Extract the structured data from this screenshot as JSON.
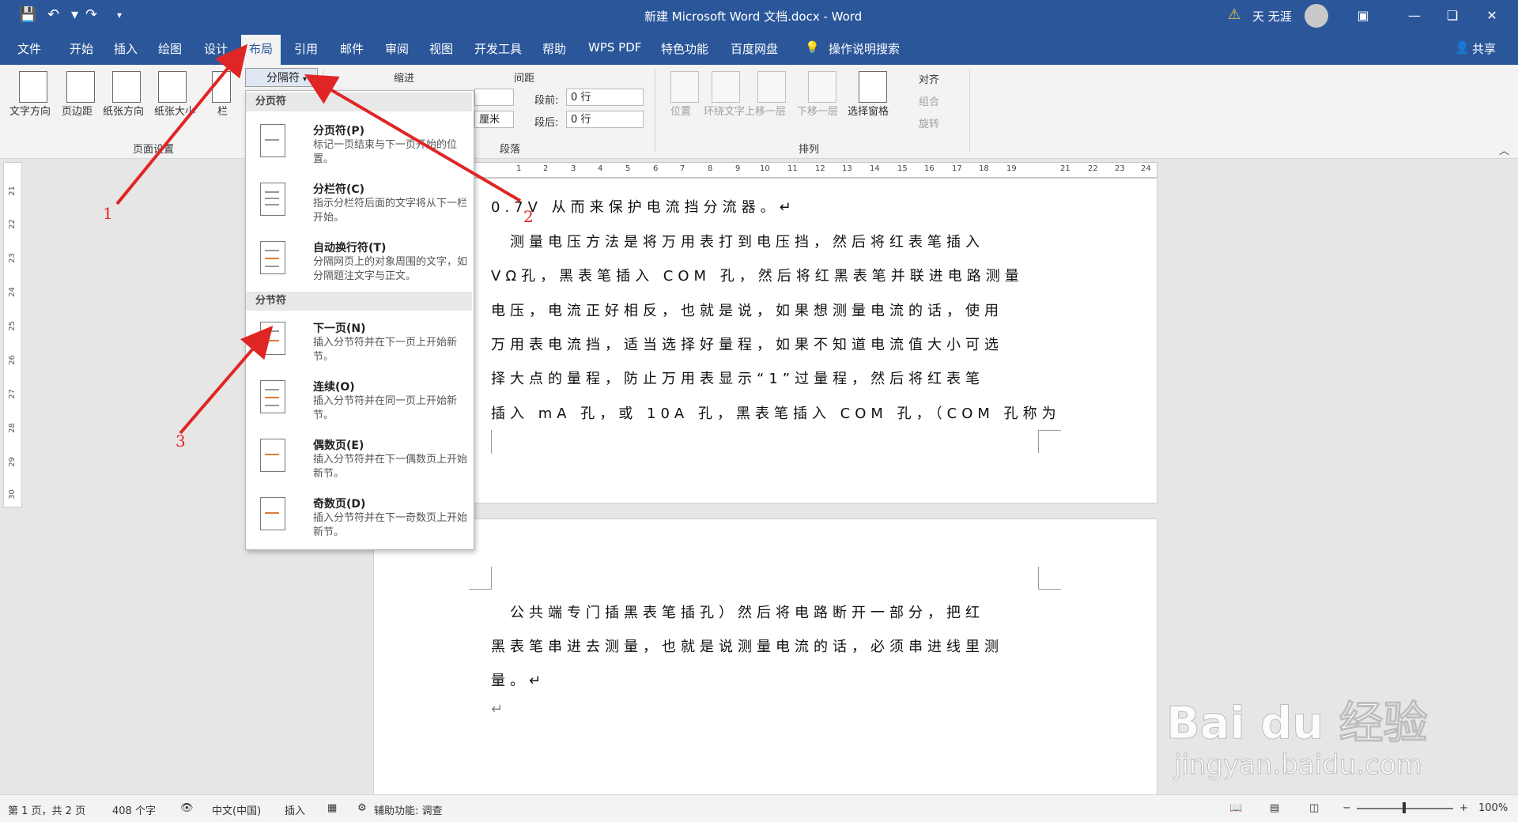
{
  "app": {
    "doc_title": "新建 Microsoft Word 文档.docx  -  Word",
    "user": "天 无涯",
    "warning_icon": "warning-icon"
  },
  "tabs": [
    "文件",
    "开始",
    "插入",
    "绘图",
    "设计",
    "布局",
    "引用",
    "邮件",
    "审阅",
    "视图",
    "开发工具",
    "帮助",
    "WPS PDF",
    "特色功能",
    "百度网盘",
    "操作说明搜索"
  ],
  "active_tab": "布局",
  "share_label": "共享",
  "ribbon": {
    "page_setup": {
      "buttons": [
        "文字方向",
        "页边距",
        "纸张方向",
        "纸张大小",
        "栏"
      ],
      "group_label": "页面设置",
      "breaks_button": "分隔符"
    },
    "indent": {
      "label": "缩进",
      "unit_text": "厘米"
    },
    "spacing": {
      "label": "间距",
      "before_label": "段前:",
      "before_value": "0 行",
      "after_label": "段后:",
      "after_value": "0 行"
    },
    "paragraph_group": "段落",
    "arrange": {
      "buttons": [
        "位置",
        "环绕文字",
        "上移一层",
        "下移一层",
        "选择窗格"
      ],
      "align": "对齐",
      "group": "组合",
      "rotate": "旋转",
      "group_label": "排列"
    }
  },
  "dropdown": {
    "section1": "分页符",
    "items1": [
      {
        "title": "分页符(P)",
        "desc": "标记一页结束与下一页开始的位置。"
      },
      {
        "title": "分栏符(C)",
        "desc": "指示分栏符后面的文字将从下一栏开始。"
      },
      {
        "title": "自动换行符(T)",
        "desc": "分隔网页上的对象周围的文字，如分隔题注文字与正文。"
      }
    ],
    "section2": "分节符",
    "items2": [
      {
        "title": "下一页(N)",
        "desc": "插入分节符并在下一页上开始新节。"
      },
      {
        "title": "连续(O)",
        "desc": "插入分节符并在同一页上开始新节。"
      },
      {
        "title": "偶数页(E)",
        "desc": "插入分节符并在下一偶数页上开始新节。"
      },
      {
        "title": "奇数页(D)",
        "desc": "插入分节符并在下一奇数页上开始新节。"
      }
    ]
  },
  "hruler_numbers": [
    "1",
    "1",
    "2",
    "3",
    "4",
    "5",
    "6",
    "7",
    "8",
    "9",
    "10",
    "11",
    "12",
    "13",
    "14",
    "15",
    "16",
    "17",
    "18",
    "19",
    "21",
    "22",
    "23",
    "24"
  ],
  "vruler_numbers": [
    "21",
    "22",
    "23",
    "24",
    "25",
    "26",
    "27",
    "28",
    "29",
    "30"
  ],
  "page1_lines": [
    "0.7V 从而来保护电流挡分流器。↵",
    "　测量电压方法是将万用表打到电压挡，然后将红表笔插入",
    "VΩ孔，黑表笔插入 COM 孔，然后将红黑表笔并联进电路测量",
    "电压，电流正好相反，也就是说，如果想测量电流的话，使用",
    "万用表电流挡，适当选择好量程，如果不知道电流值大小可选",
    "择大点的量程，防止万用表显示“1”过量程，然后将红表笔",
    "插入 mA 孔，或 10A 孔，黑表笔插入 COM 孔，（COM 孔称为"
  ],
  "page2_lines": [
    "　公共端专门插黑表笔插孔）然后将电路断开一部分，把红",
    "黑表笔串进去测量，也就是说测量电流的话，必须串进线里测",
    "量。↵",
    "↵"
  ],
  "status": {
    "page": "第 1 页，共 2 页",
    "words": "408 个字",
    "lang": "中文(中国)",
    "mode": "插入",
    "accessibility": "辅助功能: 调查",
    "zoom": "100%"
  },
  "annotations": [
    "1",
    "2",
    "3"
  ],
  "watermark": {
    "brand": "Bai du 经验",
    "url": "jingyan.baidu.com"
  },
  "colors": {
    "title_bar": "#2b579a",
    "arrow": "#e02525",
    "accent_orange": "#e07b39"
  }
}
